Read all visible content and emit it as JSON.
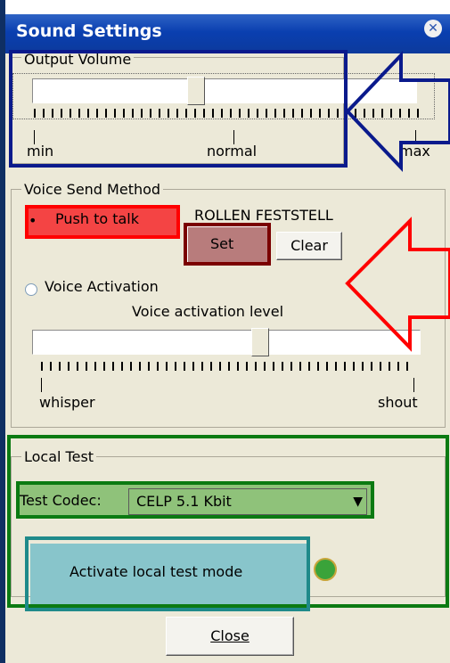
{
  "dialog": {
    "title": "Sound Settings"
  },
  "output_volume": {
    "legend": "Output Volume",
    "label_min": "min",
    "label_normal": "normal",
    "label_max": "max",
    "level": 0.5
  },
  "voice_send_method": {
    "legend": "Voice Send Method",
    "push_to_talk_label": "Push to talk",
    "push_to_talk_selected": true,
    "hotkey_text": "ROLLEN FESTSTELL",
    "set_button": "Set",
    "clear_button": "Clear",
    "voice_activation_label": "Voice Activation",
    "voice_activation_selected": false,
    "activation_level_label": "Voice activation level",
    "label_whisper": "whisper",
    "label_shout": "shout",
    "activation_level": 0.6
  },
  "local_test": {
    "legend": "Local Test",
    "codec_label": "Test Codec:",
    "codec_value": "CELP 5.1 Kbit",
    "activate_button": "Activate local test mode",
    "status_indicator": "green"
  },
  "footer": {
    "close_button": "Close"
  },
  "annotation_colors": {
    "output_volume_box": "#0a1a8c",
    "push_to_talk_box": "#ff0000",
    "set_button_box": "#7a0000",
    "local_test_box": "#0b7a12",
    "activate_button_box": "#1f8a8a",
    "arrow_blue": "#0a1a8c",
    "arrow_red": "#ff0000"
  }
}
